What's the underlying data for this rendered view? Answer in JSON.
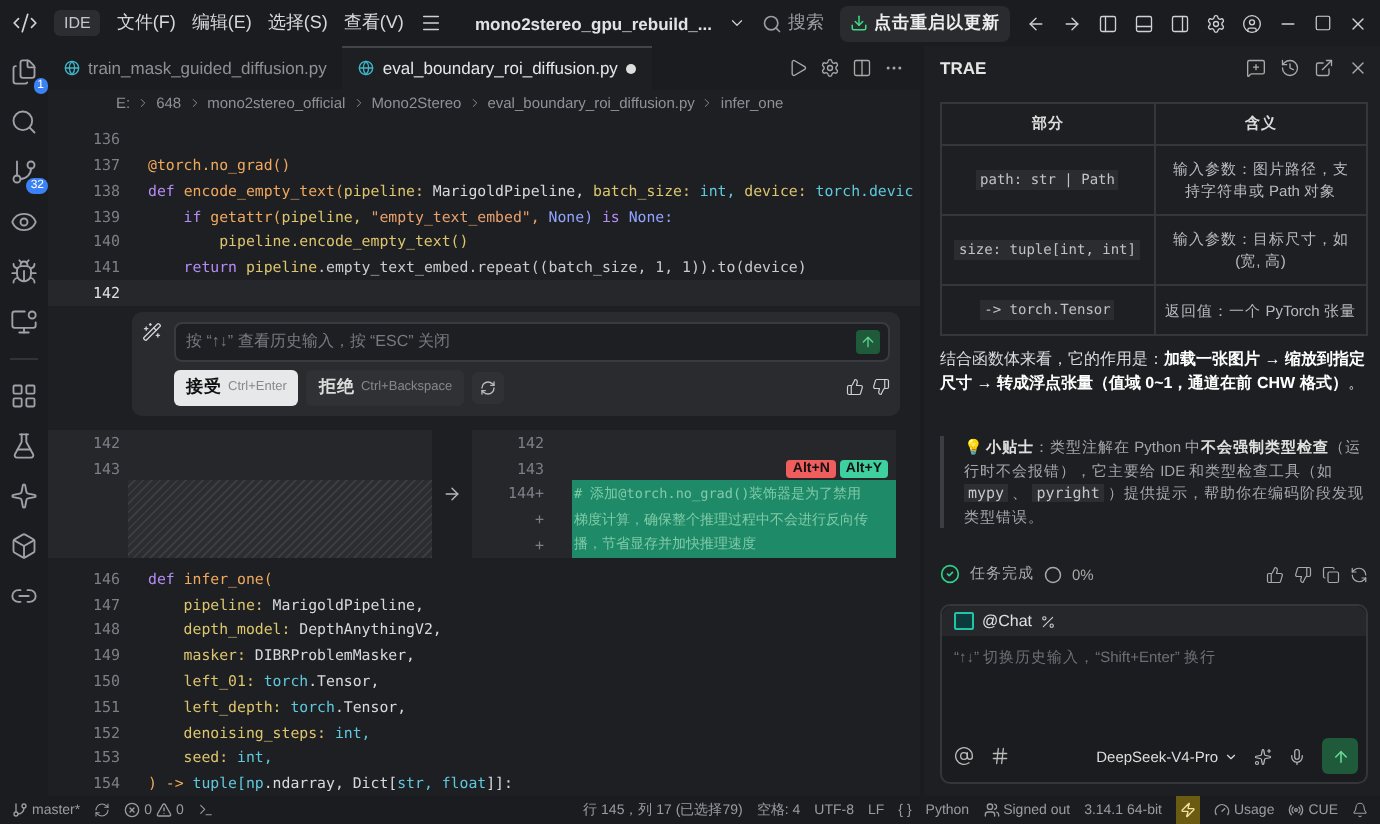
{
  "title_bar": {
    "app_badge": "IDE",
    "menus": [
      "文件(F)",
      "编辑(E)",
      "选择(S)",
      "查看(V)"
    ],
    "project": "mono2stereo_gpu_rebuild_...",
    "search": "搜索",
    "update": "点击重启以更新"
  },
  "activity_bar": {
    "badges": {
      "explorer": "1",
      "source_control": "32"
    }
  },
  "tabs": [
    {
      "label": "train_mask_guided_diffusion.py",
      "selected": false,
      "modified": false
    },
    {
      "label": "eval_boundary_roi_diffusion.py",
      "selected": true,
      "modified": true
    }
  ],
  "breadcrumb": [
    "E:",
    "648",
    "mono2stereo_official",
    "Mono2Stereo",
    "eval_boundary_roi_diffusion.py",
    "infer_one"
  ],
  "code_top": [
    {
      "number": "136",
      "current": false
    },
    {
      "number": "137",
      "current": false,
      "segments": [
        {
          "text": "@torch.",
          "kind": "deco"
        },
        {
          "text": "no_grad()",
          "kind": "fn"
        }
      ]
    },
    {
      "number": "138",
      "current": false,
      "segments": [
        {
          "text": "def ",
          "kind": "kw"
        },
        {
          "text": "encode_empty_text(",
          "kind": "fn"
        },
        {
          "text": "pipeline: ",
          "kind": "param"
        },
        {
          "text": "MarigoldPipeline, ",
          "kind": "type"
        },
        {
          "text": "batch_size: ",
          "kind": "param"
        },
        {
          "text": "int, ",
          "kind": "builtin"
        },
        {
          "text": "device: ",
          "kind": "param"
        },
        {
          "text": "torch.devic",
          "kind": "builtin"
        }
      ]
    },
    {
      "number": "139",
      "current": false,
      "segments": [
        {
          "text": "    if ",
          "kind": "kw"
        },
        {
          "text": "getattr(",
          "kind": "fn"
        },
        {
          "text": "pipeline, ",
          "kind": "param"
        },
        {
          "text": "\"empty_text_embed\", ",
          "kind": "str"
        },
        {
          "text": "None) ",
          "kind": "const"
        },
        {
          "text": "is ",
          "kind": "kw"
        },
        {
          "text": "None:",
          "kind": "const"
        }
      ]
    },
    {
      "number": "140",
      "current": false,
      "segments": [
        {
          "text": "        pipeline.encode_empty_text()",
          "kind": "param"
        }
      ]
    },
    {
      "number": "141",
      "current": false,
      "segments": [
        {
          "text": "    return ",
          "kind": "kw"
        },
        {
          "text": "pipeline",
          "kind": "param"
        },
        {
          "text": ".empty_text_embed.repeat((batch_size, 1, 1)).to(device)",
          "kind": "plain"
        }
      ]
    },
    {
      "number": "142",
      "current": true
    }
  ],
  "inline_chat": {
    "placeholder": "按 “↑↓” 查看历史输入，按 “ESC” 关闭",
    "accept": {
      "label": "接受",
      "shortcut": "Ctrl+Enter"
    },
    "reject": {
      "label": "拒绝",
      "shortcut": "Ctrl+Backspace"
    }
  },
  "diff": {
    "old_numbers": [
      "142",
      "143"
    ],
    "new_numbers": [
      "142",
      "143"
    ],
    "added": [
      {
        "number": "144",
        "marker": "+",
        "text": "# 添加@torch.no_grad()装饰器是为了禁用"
      },
      {
        "marker": "+",
        "text": "梯度计算，确保整个推理过程中不会进行反向传"
      },
      {
        "marker": "+",
        "text": "播，节省显存并加快推理速度"
      }
    ],
    "reject_key": "Alt+N",
    "accept_key": "Alt+Y"
  },
  "code_bottom": [
    {
      "number": "146",
      "current": false,
      "segments": [
        {
          "text": "def ",
          "kind": "kw"
        },
        {
          "text": "infer_one(",
          "kind": "fn"
        }
      ]
    },
    {
      "number": "147",
      "current": false,
      "segments": [
        {
          "text": "    pipeline: ",
          "kind": "param"
        },
        {
          "text": "MarigoldPipeline,",
          "kind": "type"
        }
      ]
    },
    {
      "number": "148",
      "current": false,
      "segments": [
        {
          "text": "    depth_model: ",
          "kind": "param"
        },
        {
          "text": "DepthAnythingV2,",
          "kind": "type"
        }
      ]
    },
    {
      "number": "149",
      "current": false,
      "segments": [
        {
          "text": "    masker: ",
          "kind": "param"
        },
        {
          "text": "DIBRProblemMasker,",
          "kind": "type"
        }
      ]
    },
    {
      "number": "150",
      "current": false,
      "segments": [
        {
          "text": "    left_01: ",
          "kind": "param"
        },
        {
          "text": "torch",
          "kind": "builtin"
        },
        {
          "text": ".Tensor,",
          "kind": "type"
        }
      ]
    },
    {
      "number": "151",
      "current": false,
      "segments": [
        {
          "text": "    left_depth: ",
          "kind": "param"
        },
        {
          "text": "torch",
          "kind": "builtin"
        },
        {
          "text": ".Tensor,",
          "kind": "type"
        }
      ]
    },
    {
      "number": "152",
      "current": false,
      "segments": [
        {
          "text": "    denoising_steps: ",
          "kind": "param"
        },
        {
          "text": "int,",
          "kind": "builtin"
        }
      ]
    },
    {
      "number": "153",
      "current": false,
      "segments": [
        {
          "text": "    seed: ",
          "kind": "param"
        },
        {
          "text": "int,",
          "kind": "builtin"
        }
      ]
    },
    {
      "number": "154",
      "current": false,
      "segments": [
        {
          "text": ") -> ",
          "kind": "fn"
        },
        {
          "text": "tuple[np",
          "kind": "builtin"
        },
        {
          "text": ".ndarray, Dict[",
          "kind": "type"
        },
        {
          "text": "str, float",
          "kind": "builtin"
        },
        {
          "text": "]]:",
          "kind": "type"
        }
      ]
    }
  ],
  "assistant": {
    "title": "TRAE",
    "table": {
      "columns": [
        "部分",
        "含义"
      ],
      "rows": [
        {
          "part": "path: str | Path",
          "meaning": "输入参数：图片路径，支持字符串或 Path 对象"
        },
        {
          "part": "size: tuple[int, int]",
          "meaning": "输入参数：目标尺寸，如 (宽, 高)"
        },
        {
          "part": "-> torch.Tensor",
          "meaning": "返回值：一个 PyTorch 张量"
        }
      ]
    },
    "summary": "结合函数体来看，它的作用是：**加载一张图片 → 缩放到指定尺寸 → 转成浮点张量（值域 0~1，通道在前 CHW 格式）**。",
    "tip": [
      {
        "kind": "text",
        "text": "💡 **小贴士**：类型注解在 Python 中**不会强制类型检查**（运行时不会报错），它主要给 IDE 和类型检查工具（如 "
      },
      {
        "kind": "code",
        "text": "mypy"
      },
      {
        "kind": "text",
        "text": " 、 "
      },
      {
        "kind": "code",
        "text": "pyright"
      },
      {
        "kind": "text",
        "text": " ）提供提示，帮助你在编码阶段发现类型错误。"
      }
    ],
    "task_status": "任务完成",
    "progress": "0%",
    "chat": {
      "mention": "@Chat",
      "placeholder": "“↑↓” 切换历史输入，“Shift+Enter” 换行",
      "model": "DeepSeek-V4-Pro"
    }
  },
  "status_bar": {
    "branch": "master*",
    "errors": "0",
    "warnings": "0",
    "position": "行 145，列 17 (已选择79)",
    "indent": "空格: 4",
    "encoding": "UTF-8",
    "eol": "LF",
    "braces": "{ }",
    "language": "Python",
    "account": "Signed out",
    "interpreter": "3.14.1 64-bit",
    "usage": "Usage",
    "cue": "CUE"
  }
}
